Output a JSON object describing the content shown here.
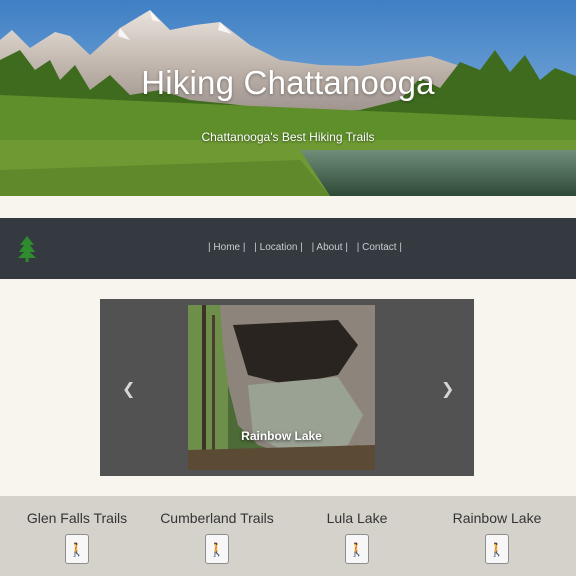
{
  "hero": {
    "title": "Hiking Chattanooga",
    "subtitle": "Chattanooga's Best Hiking Trails"
  },
  "navbar": {
    "logo_icon": "tree-icon",
    "links": [
      "| Home |",
      "| Location |",
      "| About |",
      "| Contact |"
    ]
  },
  "carousel": {
    "caption": "Rainbow Lake",
    "prev_icon": "chevron-left-icon",
    "next_icon": "chevron-right-icon"
  },
  "trails": [
    {
      "name": "Glen Falls Trails",
      "icon": "hiker-icon"
    },
    {
      "name": "Cumberland Trails",
      "icon": "hiker-icon"
    },
    {
      "name": "Lula Lake",
      "icon": "hiker-icon"
    },
    {
      "name": "Rainbow Lake",
      "icon": "hiker-icon"
    }
  ],
  "colors": {
    "navbar_bg": "#343a40",
    "page_bg": "#f8f5ef",
    "carousel_bg": "#525252",
    "trails_bg": "#d5d2cc",
    "logo_green": "#2e8b2e"
  }
}
